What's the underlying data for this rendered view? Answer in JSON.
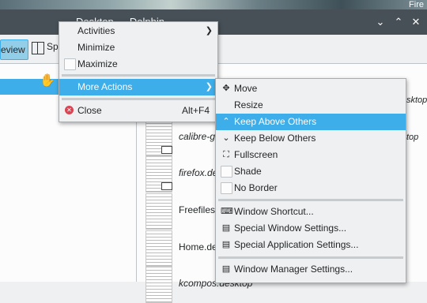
{
  "window": {
    "title": "Desktop — Dolphin",
    "corner_text": "Fire"
  },
  "toolbar": {
    "preview_label": "eview",
    "split_label": "Sp"
  },
  "content": {
    "header_fragment": "p",
    "files": [
      {
        "name": "calibre-g",
        "style": "italic"
      },
      {
        "name": "firefox.de",
        "style": "italic"
      },
      {
        "name": "Freefiles",
        "style": "plain"
      },
      {
        "name": "Home.de",
        "style": "plain"
      },
      {
        "name": "kcompos.desktop",
        "style": "italic"
      }
    ],
    "right_fragments": [
      "sktop",
      "top"
    ]
  },
  "window_menu": {
    "items": [
      {
        "label": "Activities",
        "has_submenu": true
      },
      {
        "label": "Minimize"
      },
      {
        "label": "Maximize",
        "checkbox": true
      },
      {
        "label": "More Actions",
        "has_submenu": true,
        "selected": true
      },
      {
        "label": "Close",
        "shortcut": "Alt+F4",
        "icon": "close-icon"
      }
    ]
  },
  "more_actions_menu": {
    "items": [
      {
        "label": "Move",
        "icon": "move-icon"
      },
      {
        "label": "Resize"
      },
      {
        "label": "Keep Above Others",
        "icon": "keep-above-icon",
        "selected": true
      },
      {
        "label": "Keep Below Others",
        "icon": "keep-below-icon"
      },
      {
        "label": "Fullscreen",
        "icon": "fullscreen-icon"
      },
      {
        "label": "Shade",
        "checkbox": true
      },
      {
        "label": "No Border",
        "checkbox": true
      },
      {
        "label": "Window Shortcut...",
        "icon": "shortcut-icon"
      },
      {
        "label": "Special Window Settings...",
        "icon": "window-settings-icon"
      },
      {
        "label": "Special Application Settings...",
        "icon": "app-settings-icon"
      },
      {
        "label": "Window Manager Settings...",
        "icon": "wm-settings-icon"
      }
    ]
  },
  "colors": {
    "accent": "#3daee9",
    "titlebar": "#475057",
    "menu_bg": "#eff0f1",
    "close_red": "#da4453"
  }
}
